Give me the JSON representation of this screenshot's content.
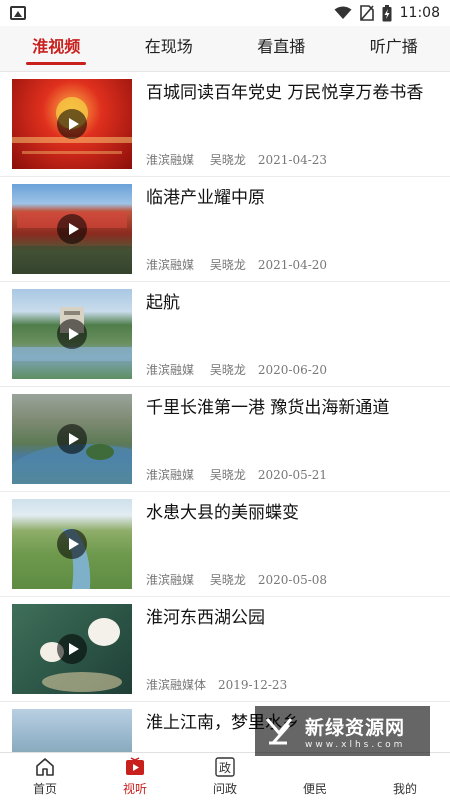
{
  "status_bar": {
    "time": "11:08",
    "icons": [
      "image-icon",
      "wifi-icon",
      "no-sim-icon",
      "battery-charging-icon"
    ]
  },
  "tabs": [
    {
      "label": "淮视频",
      "active": true
    },
    {
      "label": "在现场",
      "active": false
    },
    {
      "label": "看直播",
      "active": false
    },
    {
      "label": "听广播",
      "active": false
    }
  ],
  "videos": [
    {
      "title": "百城同读百年党史 万民悦享万卷书香",
      "source": "淮滨融媒",
      "author": "吴晓龙",
      "date": "2021-04-23"
    },
    {
      "title": "临港产业耀中原",
      "source": "淮滨融媒",
      "author": "吴晓龙",
      "date": "2021-04-20"
    },
    {
      "title": "起航",
      "source": "淮滨融媒",
      "author": "吴晓龙",
      "date": "2020-06-20"
    },
    {
      "title": "千里长淮第一港 豫货出海新通道",
      "source": "淮滨融媒",
      "author": "吴晓龙",
      "date": "2020-05-21"
    },
    {
      "title": "水患大县的美丽蝶变",
      "source": "淮滨融媒",
      "author": "吴晓龙",
      "date": "2020-05-08"
    },
    {
      "title": "淮河东西湖公园",
      "source": "淮滨融媒体",
      "author": "",
      "date": "2019-12-23"
    },
    {
      "title": "淮上江南，梦里水乡",
      "source": "",
      "author": "",
      "date": ""
    }
  ],
  "bottom_nav": [
    {
      "label": "首页",
      "icon": "home-icon",
      "active": false
    },
    {
      "label": "视听",
      "icon": "tv-play-icon",
      "active": true
    },
    {
      "label": "问政",
      "icon": "zheng-icon",
      "active": false
    },
    {
      "label": "便民",
      "icon": "",
      "active": false
    },
    {
      "label": "我的",
      "icon": "",
      "active": false
    }
  ],
  "watermark": {
    "text": "新绿资源网",
    "sub": "www.xlhs.com"
  },
  "colors": {
    "accent": "#c8201d"
  }
}
